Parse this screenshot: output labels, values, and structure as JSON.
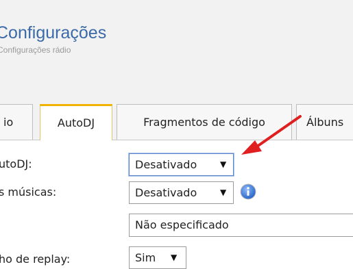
{
  "header": {
    "title": "Configurações",
    "subtitle": "Configurações rádio"
  },
  "tabs": [
    {
      "label": "io"
    },
    {
      "label": "AutoDJ"
    },
    {
      "label": "Fragmentos de código"
    },
    {
      "label": "Álbuns"
    }
  ],
  "form": {
    "autodj": {
      "label": "utoDJ:",
      "value": "Desativado"
    },
    "musicas": {
      "label": "s músicas:",
      "value": "Desativado"
    },
    "field3": {
      "value": "Não especificado"
    },
    "replay": {
      "label": "ho de replay:",
      "value": "Sim"
    }
  },
  "icons": {
    "info": "info-icon",
    "dropdown": "triangle-down-icon",
    "annotation": "red-arrow-icon"
  },
  "colors": {
    "title": "#3b6aa8",
    "active_tab_accent": "#f0b400",
    "info": "#2b6fd6",
    "annotation_arrow": "#e02020"
  }
}
